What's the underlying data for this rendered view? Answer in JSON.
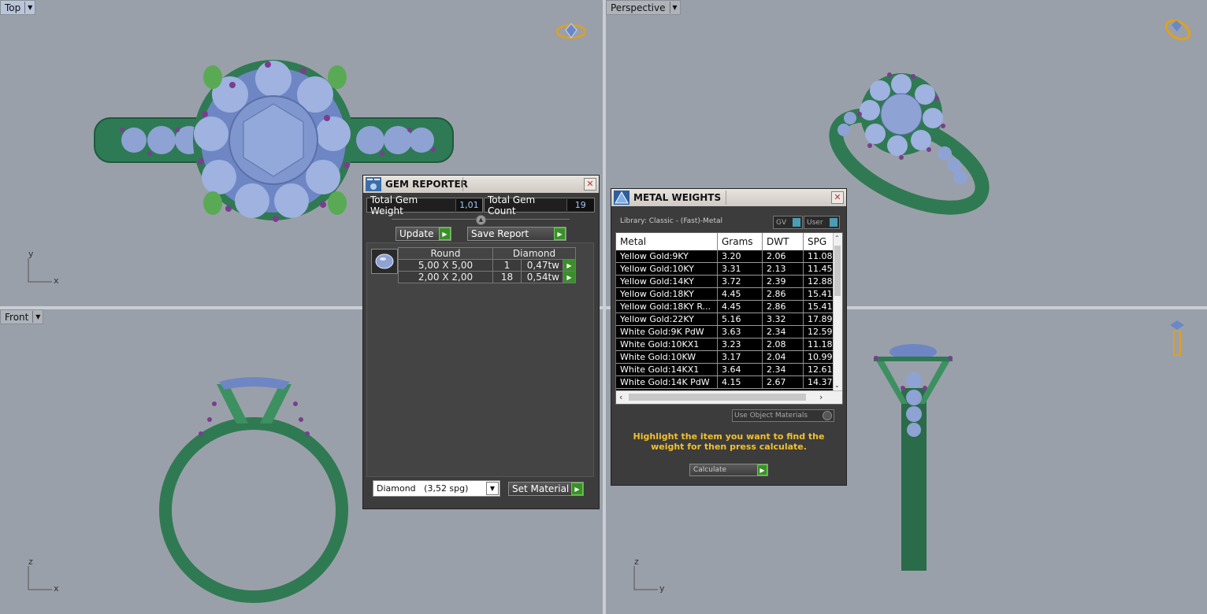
{
  "viewports": {
    "top": {
      "label": "Top",
      "axis_v": "y",
      "axis_h": "x"
    },
    "perspective": {
      "label": "Perspective"
    },
    "front": {
      "label": "Front",
      "axis_v": "z",
      "axis_h": "x"
    },
    "right": {
      "axis_v": "z",
      "axis_h": "y"
    }
  },
  "gem_reporter": {
    "title": "GEM REPORTER",
    "total_weight_label": "Total Gem Weight",
    "total_weight_value": "1,01",
    "total_count_label": "Total Gem Count",
    "total_count_value": "19",
    "update_label": "Update",
    "save_label": "Save Report",
    "table": {
      "headers": [
        "Round",
        "Diamond"
      ],
      "rows": [
        {
          "size": "5,00 X 5,00",
          "count": "1",
          "weight": "0,47tw"
        },
        {
          "size": "2,00 X 2,00",
          "count": "18",
          "weight": "0,54tw"
        }
      ]
    },
    "material_select": "Diamond   (3,52 spg)",
    "set_material_label": "Set Material"
  },
  "metal_weights": {
    "title": "METAL WEIGHTS",
    "library": "Library: Classic - (Fast)-Metal",
    "gv_label": "GV",
    "user_label": "User",
    "columns": [
      "Metal",
      "Grams",
      "DWT",
      "SPG"
    ],
    "rows": [
      [
        "Yellow Gold:9KY",
        "3.20",
        "2.06",
        "11.08"
      ],
      [
        "Yellow Gold:10KY",
        "3.31",
        "2.13",
        "11.45"
      ],
      [
        "Yellow Gold:14KY",
        "3.72",
        "2.39",
        "12.88"
      ],
      [
        "Yellow Gold:18KY",
        "4.45",
        "2.86",
        "15.41"
      ],
      [
        "Yellow Gold:18KY R...",
        "4.45",
        "2.86",
        "15.41"
      ],
      [
        "Yellow Gold:22KY",
        "5.16",
        "3.32",
        "17.89"
      ],
      [
        "White Gold:9K PdW",
        "3.63",
        "2.34",
        "12.59"
      ],
      [
        "White Gold:10KX1",
        "3.23",
        "2.08",
        "11.18"
      ],
      [
        "White Gold:10KW",
        "3.17",
        "2.04",
        "10.99"
      ],
      [
        "White Gold:14KX1",
        "3.64",
        "2.34",
        "12.61"
      ],
      [
        "White Gold:14K PdW",
        "4.15",
        "2.67",
        "14.37"
      ]
    ],
    "use_object_materials": "Use Object Materials",
    "hint": "Highlight the item you want to find the weight for then press calculate.",
    "calculate_label": "Calculate"
  },
  "colors": {
    "metal": "#2f7a52",
    "gem": "#8fa3d6",
    "prong_bead": "#7a3d8f",
    "viewport_bg": "#9aa0a9",
    "accent_hint": "#f2c12e"
  }
}
